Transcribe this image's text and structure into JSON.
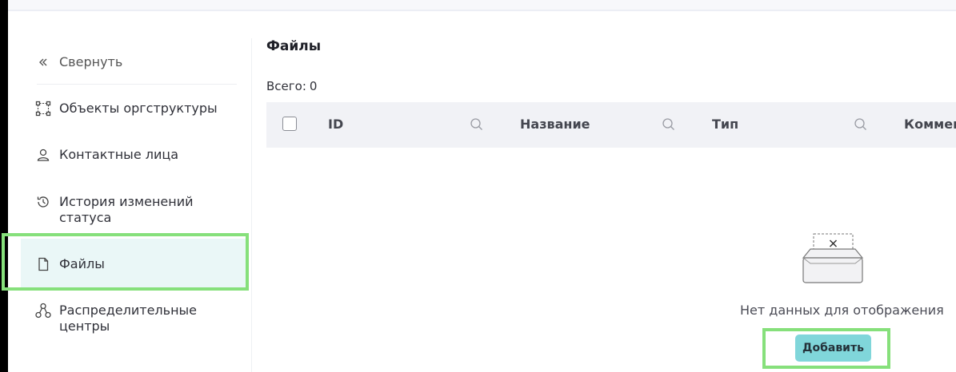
{
  "sidebar": {
    "collapse_label": "Свернуть",
    "items": [
      {
        "label": "Объекты оргструктуры",
        "icon": "org-structure-icon"
      },
      {
        "label": "Контактные лица",
        "icon": "user-icon"
      },
      {
        "label": "История изменений статуса",
        "icon": "history-icon"
      },
      {
        "label": "Файлы",
        "icon": "file-icon",
        "active": true
      },
      {
        "label": "Распределительные центры",
        "icon": "network-icon"
      }
    ]
  },
  "main": {
    "title": "Файлы",
    "total_label": "Всего:",
    "total_value": "0",
    "columns": [
      "ID",
      "Название",
      "Тип",
      "Комментарий"
    ],
    "empty_text": "Нет данных для отображения",
    "add_button_label": "Добавить"
  },
  "colors": {
    "accent": "#80d6da",
    "active_bg": "#eaf7f7",
    "highlight_frame": "#86e07b",
    "table_header_bg": "#f1f2f6"
  }
}
